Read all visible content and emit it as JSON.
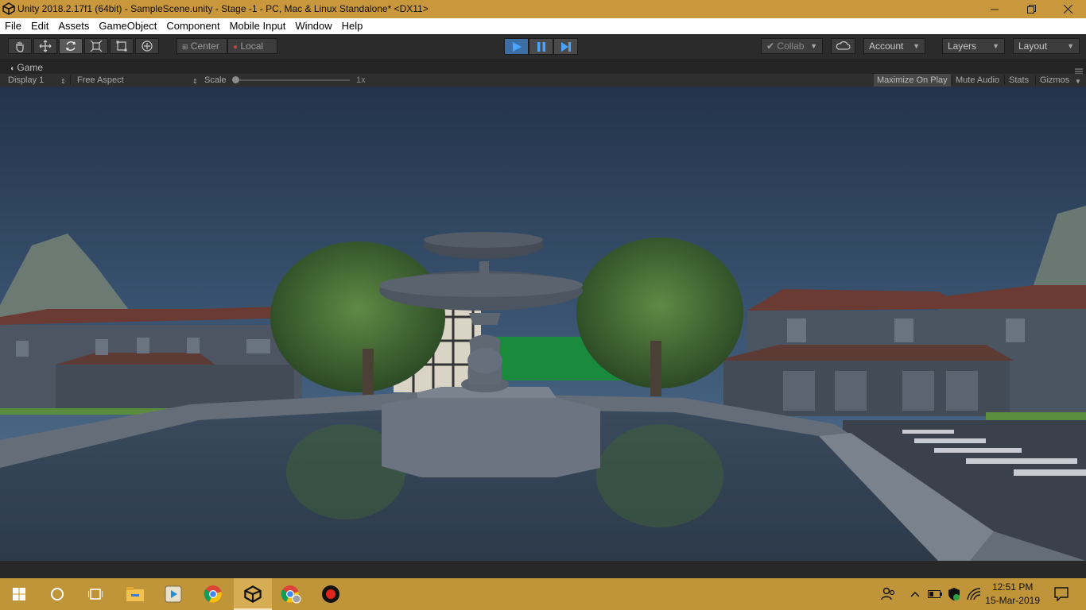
{
  "window": {
    "title": "Unity 2018.2.17f1 (64bit) - SampleScene.unity - Stage -1 - PC, Mac & Linux Standalone* <DX11>"
  },
  "menu": [
    "File",
    "Edit",
    "Assets",
    "GameObject",
    "Component",
    "Mobile Input",
    "Window",
    "Help"
  ],
  "toolbar": {
    "pivot_mode": "Center",
    "pivot_space": "Local",
    "collab": "Collab",
    "account": "Account",
    "layers": "Layers",
    "layout": "Layout",
    "play_active": true
  },
  "game_view": {
    "tab_label": "Game",
    "display": "Display 1",
    "aspect": "Free Aspect",
    "scale_label": "Scale",
    "scale_value": "1x",
    "scale_fraction": 0.0,
    "maximize_on_play": "Maximize On Play",
    "mute_audio": "Mute Audio",
    "stats": "Stats",
    "gizmos": "Gizmos"
  },
  "taskbar": {
    "time": "12:51 PM",
    "date": "15-Mar-2019",
    "apps": [
      "start-icon",
      "cortana-icon",
      "task-view-icon",
      "file-explorer-icon",
      "media-player-icon",
      "chrome-icon",
      "unity-icon",
      "chrome-profile-icon",
      "recorder-icon"
    ],
    "active_app": "unity-icon"
  },
  "colors": {
    "title_bar": "#c9973c",
    "taskbar": "#c0953a",
    "play_blue": "#3a6ea5",
    "sky_top": "#23334a",
    "sky_bottom": "#4f6f8e"
  }
}
